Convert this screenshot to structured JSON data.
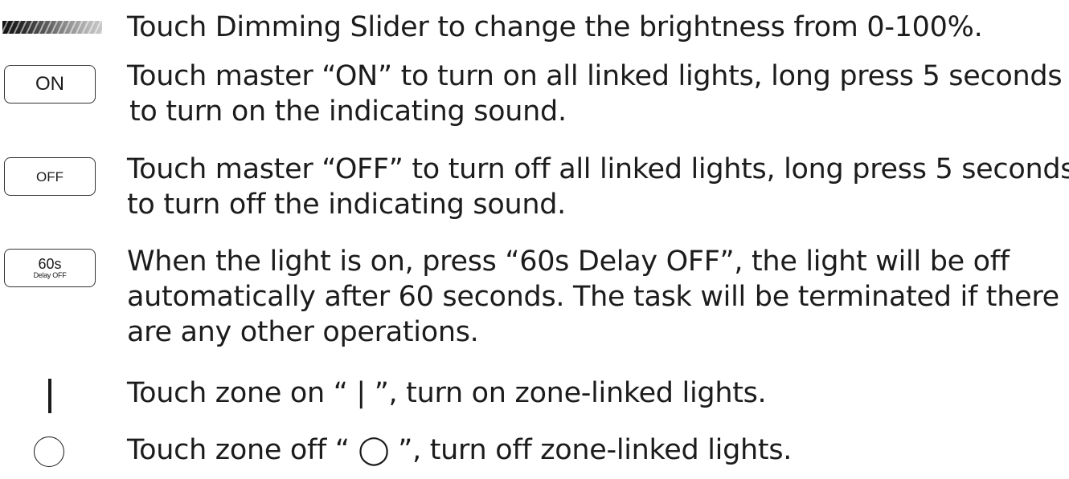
{
  "items": [
    {
      "icon": "dimming-slider-icon",
      "lines": [
        "Touch Dimming Slider to change the brightness from 0-100%."
      ]
    },
    {
      "icon": "on-key-icon",
      "key_label": "ON",
      "lines": [
        "Touch master “ON” to turn on all linked lights, long press 5 seconds",
        "to turn on the indicating sound."
      ]
    },
    {
      "icon": "off-key-icon",
      "key_label": "OFF",
      "lines": [
        "Touch master “OFF” to turn off all linked lights, long press 5 seconds",
        "to turn off the indicating sound."
      ]
    },
    {
      "icon": "delay-off-key-icon",
      "key_label_main": "60s",
      "key_label_sub": "Delay OFF",
      "lines": [
        "When the light is on, press “60s Delay OFF”, the light will be off",
        "automatically after 60 seconds. The task will be terminated if there",
        "are any other operations."
      ]
    },
    {
      "icon": "zone-on-bar-icon",
      "lines": [
        "Touch zone on “ | ”, turn on zone-linked lights."
      ]
    },
    {
      "icon": "zone-off-circle-icon",
      "lines": [
        "Touch zone off “ ◯ ”, turn off zone-linked lights."
      ]
    }
  ]
}
